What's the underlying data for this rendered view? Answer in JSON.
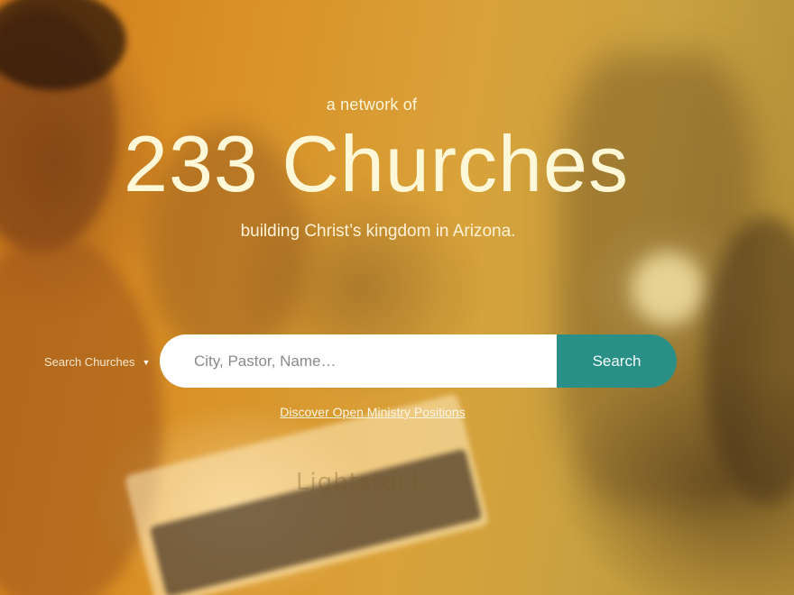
{
  "hero": {
    "kicker": "a network of",
    "title": "233 Churches",
    "subtitle": "building Christ’s kingdom in Arizona.",
    "watermark": "Lightstock"
  },
  "search": {
    "type_label": "Search Churches",
    "placeholder": "City, Pastor, Name…",
    "button_label": "Search"
  },
  "links": {
    "discover": "Discover Open Ministry Positions"
  },
  "colors": {
    "accent": "#2a8f86",
    "overlay_orange": "#d98f25",
    "overlay_gold": "#c9a140"
  },
  "icons": {
    "dropdown": "caret-down-icon"
  }
}
